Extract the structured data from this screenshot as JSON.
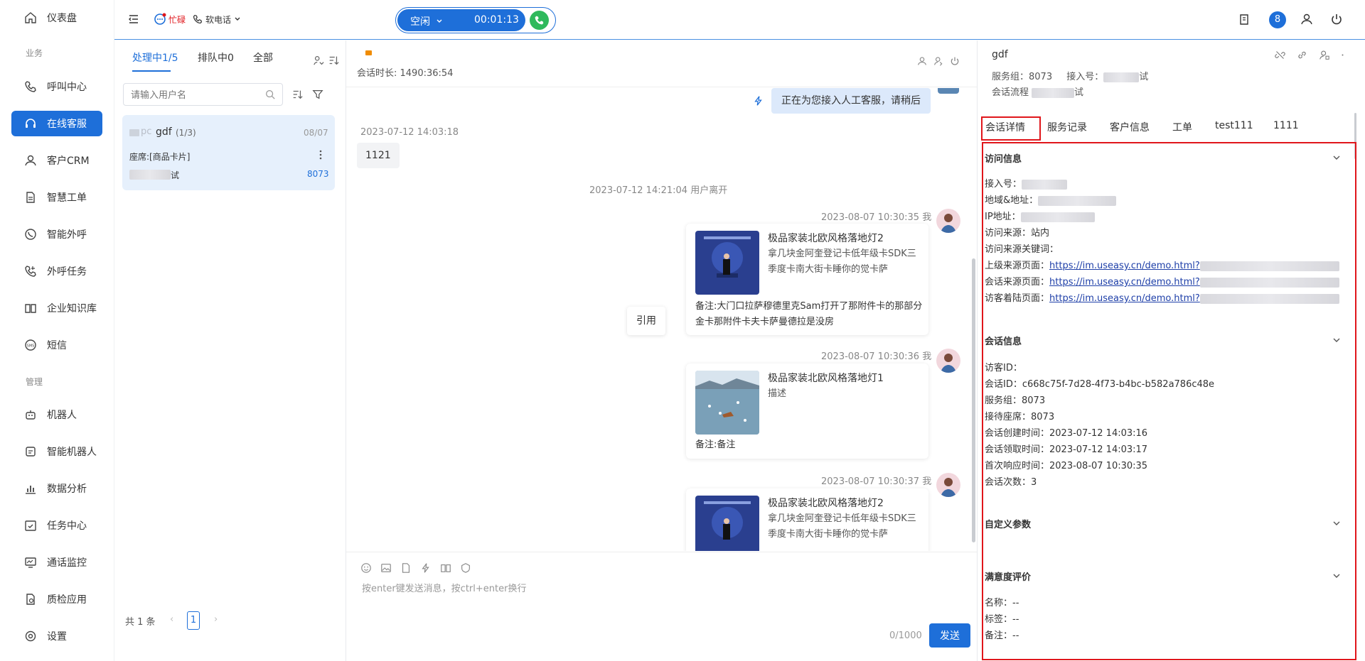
{
  "sidebar": {
    "items": [
      {
        "label": "仪表盘",
        "icon": "home-icon"
      },
      {
        "section": "业务"
      },
      {
        "label": "呼叫中心",
        "icon": "phone-icon"
      },
      {
        "label": "在线客服",
        "icon": "headset-icon",
        "active": true
      },
      {
        "label": "客户CRM",
        "icon": "user-icon"
      },
      {
        "label": "智慧工单",
        "icon": "document-icon"
      },
      {
        "label": "智能外呼",
        "icon": "whatsapp-phone-icon"
      },
      {
        "label": "外呼任务",
        "icon": "phone-task-icon"
      },
      {
        "label": "企业知识库",
        "icon": "book-icon"
      },
      {
        "label": "短信",
        "icon": "sms-icon"
      },
      {
        "section": "管理"
      },
      {
        "label": "机器人",
        "icon": "robot-icon"
      },
      {
        "label": "智能机器人",
        "icon": "smart-robot-icon"
      },
      {
        "label": "数据分析",
        "icon": "bar-chart-icon"
      },
      {
        "label": "任务中心",
        "icon": "calendar-check-icon"
      },
      {
        "label": "通话监控",
        "icon": "monitor-icon"
      },
      {
        "label": "质检应用",
        "icon": "quality-icon"
      },
      {
        "label": "设置",
        "icon": "settings-icon"
      }
    ]
  },
  "topbar": {
    "busy_label": "忙碌",
    "phone_mode": "软电话",
    "status": "空闲",
    "timer": "00:01:13",
    "badge_count": "8"
  },
  "conv_list": {
    "tabs": [
      "处理中1/5",
      "排队中0",
      "全部"
    ],
    "search_placeholder": "请输入用户名",
    "card": {
      "channel": "pc",
      "name": "gdf",
      "count": "(1/3)",
      "date": "08/07",
      "seat": "座席:[商品卡片]",
      "suffix": "试",
      "group": "8073"
    },
    "pager": {
      "total": "共 1 条",
      "page": "1"
    }
  },
  "chat": {
    "duration": "会话时长: 1490:36:54",
    "messages": {
      "system_reply": "正在为您接入人工客服，请稍后",
      "t1": "2023-07-12 14:03:18",
      "m1": "1121",
      "left_notice": "2023-07-12 14:21:04 用户离开",
      "t2": "2023-08-07 10:30:35 我",
      "card1_title": "极品家装北欧风格落地灯2",
      "card1_desc": "拿几块金阿奎登记卡低年级卡SDK三季度卡南大街卡睡你的觉卡萨",
      "card1_note": "备注:大门口拉萨穆德里克Sam打开了那附件卡的那部分金卡那附件卡夫卡萨曼德拉是没房",
      "quote": "引用",
      "t3": "2023-08-07 10:30:36 我",
      "card2_title": "极品家装北欧风格落地灯1",
      "card2_desc": "描述",
      "card2_note": "备注:备注",
      "t4": "2023-08-07 10:30:37 我",
      "card3_title": "极品家装北欧风格落地灯2",
      "card3_desc": "拿几块金阿奎登记卡低年级卡SDK三季度卡南大街卡睡你的觉卡萨"
    },
    "input_placeholder": "按enter键发送消息，按ctrl+enter换行",
    "counter": "0/1000",
    "send": "发送"
  },
  "detail": {
    "name": "gdf",
    "group_label": "服务组：8073",
    "access_label": "接入号：",
    "access_suffix": "试",
    "flow_label": "会话流程",
    "flow_suffix": "试",
    "tabs": [
      "会话详情",
      "服务记录",
      "客户信息",
      "工单",
      "test111",
      "1111"
    ],
    "visit_title": "访问信息",
    "visit": {
      "access": "接入号：",
      "region": "地域&地址：",
      "ip": "IP地址：",
      "source": "访问来源：站内",
      "keyword": "访问来源关键词：",
      "parent_label": "上级来源页面：",
      "session_src_label": "会话来源页面：",
      "landing_label": "访客着陆页面：",
      "url": "https://im.useasy.cn/demo.html?"
    },
    "session_title": "会话信息",
    "session": {
      "visitor_id": "访客ID：",
      "session_id": "会话ID：c668c75f-7d28-4f73-b4bc-b582a786c48e",
      "group": "服务组：8073",
      "seat": "接待座席：8073",
      "created": "会话创建时间：2023-07-12 14:03:16",
      "claimed": "会话领取时间：2023-07-12 14:03:17",
      "first_resp": "首次响应时间：2023-08-07 10:30:35",
      "count": "会话次数：3"
    },
    "custom_title": "自定义参数",
    "rating_title": "满意度评价",
    "rating": {
      "name": "名称：--",
      "tag": "标签：--",
      "note": "备注：--"
    }
  },
  "colors": {
    "primary": "#1e6fd9",
    "highlight": "#e0161b",
    "busy": "#e0161b",
    "call_green": "#2fb95c"
  }
}
